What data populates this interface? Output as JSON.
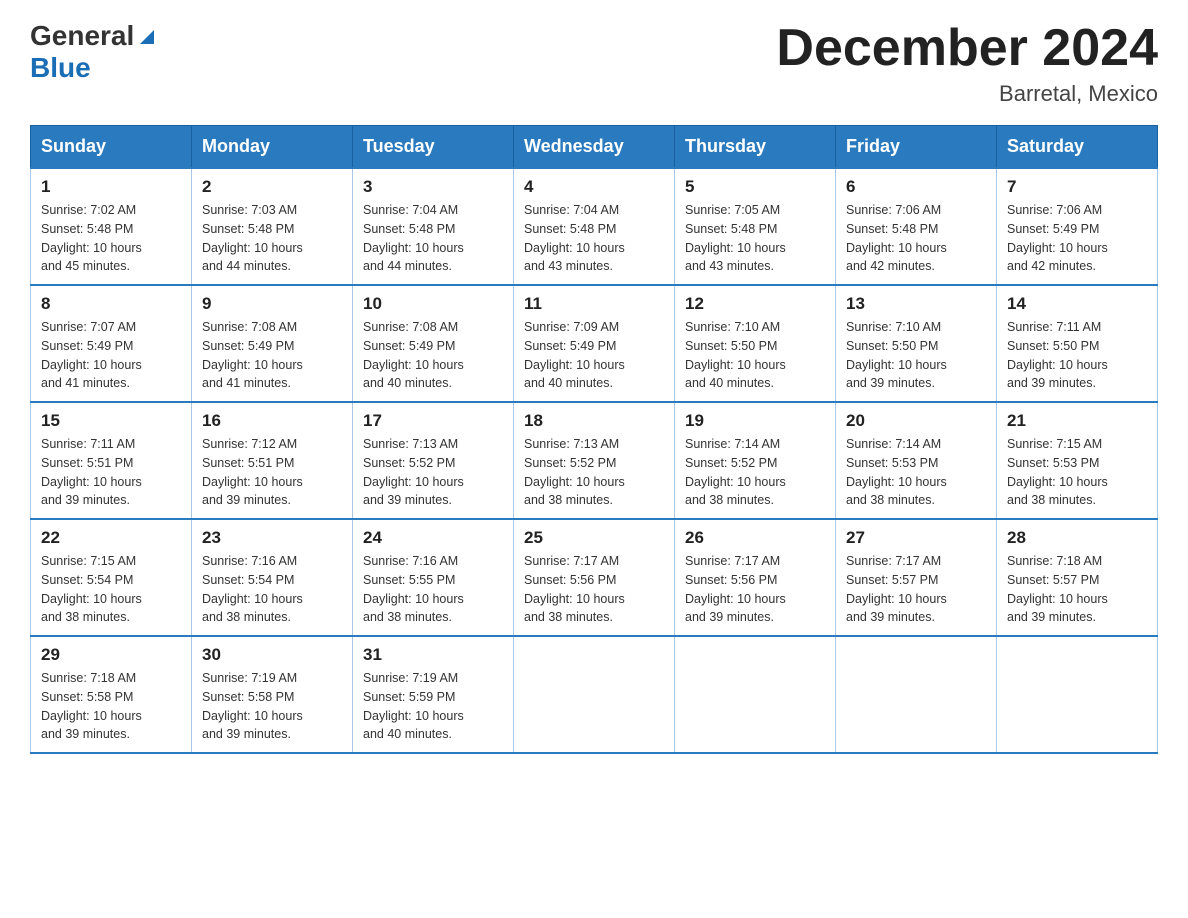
{
  "header": {
    "logo_general": "General",
    "logo_blue": "Blue",
    "month_title": "December 2024",
    "location": "Barretal, Mexico"
  },
  "days_of_week": [
    "Sunday",
    "Monday",
    "Tuesday",
    "Wednesday",
    "Thursday",
    "Friday",
    "Saturday"
  ],
  "weeks": [
    [
      {
        "day": "1",
        "sunrise": "7:02 AM",
        "sunset": "5:48 PM",
        "daylight": "10 hours and 45 minutes."
      },
      {
        "day": "2",
        "sunrise": "7:03 AM",
        "sunset": "5:48 PM",
        "daylight": "10 hours and 44 minutes."
      },
      {
        "day": "3",
        "sunrise": "7:04 AM",
        "sunset": "5:48 PM",
        "daylight": "10 hours and 44 minutes."
      },
      {
        "day": "4",
        "sunrise": "7:04 AM",
        "sunset": "5:48 PM",
        "daylight": "10 hours and 43 minutes."
      },
      {
        "day": "5",
        "sunrise": "7:05 AM",
        "sunset": "5:48 PM",
        "daylight": "10 hours and 43 minutes."
      },
      {
        "day": "6",
        "sunrise": "7:06 AM",
        "sunset": "5:48 PM",
        "daylight": "10 hours and 42 minutes."
      },
      {
        "day": "7",
        "sunrise": "7:06 AM",
        "sunset": "5:49 PM",
        "daylight": "10 hours and 42 minutes."
      }
    ],
    [
      {
        "day": "8",
        "sunrise": "7:07 AM",
        "sunset": "5:49 PM",
        "daylight": "10 hours and 41 minutes."
      },
      {
        "day": "9",
        "sunrise": "7:08 AM",
        "sunset": "5:49 PM",
        "daylight": "10 hours and 41 minutes."
      },
      {
        "day": "10",
        "sunrise": "7:08 AM",
        "sunset": "5:49 PM",
        "daylight": "10 hours and 40 minutes."
      },
      {
        "day": "11",
        "sunrise": "7:09 AM",
        "sunset": "5:49 PM",
        "daylight": "10 hours and 40 minutes."
      },
      {
        "day": "12",
        "sunrise": "7:10 AM",
        "sunset": "5:50 PM",
        "daylight": "10 hours and 40 minutes."
      },
      {
        "day": "13",
        "sunrise": "7:10 AM",
        "sunset": "5:50 PM",
        "daylight": "10 hours and 39 minutes."
      },
      {
        "day": "14",
        "sunrise": "7:11 AM",
        "sunset": "5:50 PM",
        "daylight": "10 hours and 39 minutes."
      }
    ],
    [
      {
        "day": "15",
        "sunrise": "7:11 AM",
        "sunset": "5:51 PM",
        "daylight": "10 hours and 39 minutes."
      },
      {
        "day": "16",
        "sunrise": "7:12 AM",
        "sunset": "5:51 PM",
        "daylight": "10 hours and 39 minutes."
      },
      {
        "day": "17",
        "sunrise": "7:13 AM",
        "sunset": "5:52 PM",
        "daylight": "10 hours and 39 minutes."
      },
      {
        "day": "18",
        "sunrise": "7:13 AM",
        "sunset": "5:52 PM",
        "daylight": "10 hours and 38 minutes."
      },
      {
        "day": "19",
        "sunrise": "7:14 AM",
        "sunset": "5:52 PM",
        "daylight": "10 hours and 38 minutes."
      },
      {
        "day": "20",
        "sunrise": "7:14 AM",
        "sunset": "5:53 PM",
        "daylight": "10 hours and 38 minutes."
      },
      {
        "day": "21",
        "sunrise": "7:15 AM",
        "sunset": "5:53 PM",
        "daylight": "10 hours and 38 minutes."
      }
    ],
    [
      {
        "day": "22",
        "sunrise": "7:15 AM",
        "sunset": "5:54 PM",
        "daylight": "10 hours and 38 minutes."
      },
      {
        "day": "23",
        "sunrise": "7:16 AM",
        "sunset": "5:54 PM",
        "daylight": "10 hours and 38 minutes."
      },
      {
        "day": "24",
        "sunrise": "7:16 AM",
        "sunset": "5:55 PM",
        "daylight": "10 hours and 38 minutes."
      },
      {
        "day": "25",
        "sunrise": "7:17 AM",
        "sunset": "5:56 PM",
        "daylight": "10 hours and 38 minutes."
      },
      {
        "day": "26",
        "sunrise": "7:17 AM",
        "sunset": "5:56 PM",
        "daylight": "10 hours and 39 minutes."
      },
      {
        "day": "27",
        "sunrise": "7:17 AM",
        "sunset": "5:57 PM",
        "daylight": "10 hours and 39 minutes."
      },
      {
        "day": "28",
        "sunrise": "7:18 AM",
        "sunset": "5:57 PM",
        "daylight": "10 hours and 39 minutes."
      }
    ],
    [
      {
        "day": "29",
        "sunrise": "7:18 AM",
        "sunset": "5:58 PM",
        "daylight": "10 hours and 39 minutes."
      },
      {
        "day": "30",
        "sunrise": "7:19 AM",
        "sunset": "5:58 PM",
        "daylight": "10 hours and 39 minutes."
      },
      {
        "day": "31",
        "sunrise": "7:19 AM",
        "sunset": "5:59 PM",
        "daylight": "10 hours and 40 minutes."
      },
      null,
      null,
      null,
      null
    ]
  ],
  "labels": {
    "sunrise": "Sunrise:",
    "sunset": "Sunset:",
    "daylight": "Daylight:"
  }
}
